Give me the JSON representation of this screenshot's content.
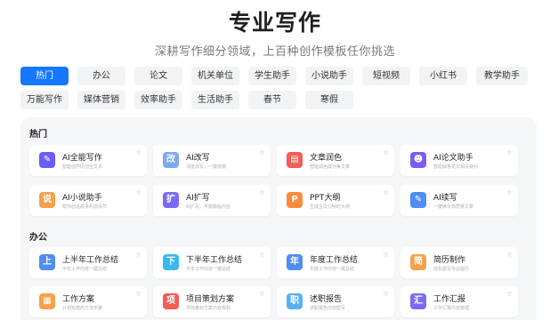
{
  "header": {
    "title": "专业写作",
    "subtitle": "深耕写作细分领域，上百种创作模板任你挑选"
  },
  "tabs": [
    {
      "label": "热门",
      "active": true
    },
    {
      "label": "办公"
    },
    {
      "label": "论文"
    },
    {
      "label": "机关单位"
    },
    {
      "label": "学生助手"
    },
    {
      "label": "小说助手"
    },
    {
      "label": "短视频"
    },
    {
      "label": "小红书"
    },
    {
      "label": "教学助手"
    },
    {
      "label": "万能写作"
    },
    {
      "label": "媒体营销"
    },
    {
      "label": "效率助手"
    },
    {
      "label": "生活助手"
    },
    {
      "label": "春节"
    },
    {
      "label": "寒假"
    }
  ],
  "sections": [
    {
      "title": "热门",
      "cards": [
        {
          "name": "AI全能写作",
          "desc": "智能创作原创全文本",
          "icon": "pen-icon",
          "glyph": "✎",
          "color": "#6b5cf6"
        },
        {
          "name": "AI改写",
          "desc": "深度改写，一键成稿",
          "icon": "rewrite-icon",
          "glyph": "改",
          "color": "#7ea8f0"
        },
        {
          "name": "文章润色",
          "desc": "智能润色成为美文章",
          "icon": "document-icon",
          "glyph": "▤",
          "color": "#f25c54"
        },
        {
          "name": "AI论文助手",
          "desc": "智能解答论文相关疑问",
          "icon": "robot-icon",
          "glyph": "☻",
          "color": "#7c5cf0"
        },
        {
          "name": "AI小说助手",
          "desc": "帮你创造故事构造情节",
          "icon": "story-icon",
          "glyph": "说",
          "color": "#f6a04a"
        },
        {
          "name": "AI扩写",
          "desc": "AI扩写，丰富篇幅内容",
          "icon": "expand-icon",
          "glyph": "扩",
          "color": "#7a6cf2"
        },
        {
          "name": "PPT大纲",
          "desc": "生成主次分明的大纲",
          "icon": "ppt-icon",
          "glyph": "P",
          "color": "#ff8a3d"
        },
        {
          "name": "AI续写",
          "desc": "一键续写高质量文章",
          "icon": "continue-icon",
          "glyph": "✎",
          "color": "#4e8df5"
        }
      ]
    },
    {
      "title": "办公",
      "cards": [
        {
          "name": "上半年工作总结",
          "desc": "半年工作内容一键总结",
          "icon": "summary-icon",
          "glyph": "上",
          "color": "#4e8df5"
        },
        {
          "name": "下半年工作总结",
          "desc": "半年工作内容一键总结",
          "icon": "summary-icon",
          "glyph": "下",
          "color": "#38b8f2"
        },
        {
          "name": "年度工作总结",
          "desc": "年度工作内容一键总结",
          "icon": "year-icon",
          "glyph": "年",
          "color": "#4e8df5"
        },
        {
          "name": "简历制作",
          "desc": "轻松撰写专业履历",
          "icon": "resume-icon",
          "glyph": "简",
          "color": "#f6a04a"
        },
        {
          "name": "工作方案",
          "desc": "计划实施的方法步骤",
          "icon": "plan-icon",
          "glyph": "▦",
          "color": "#f6a04a"
        },
        {
          "name": "项目策划方案",
          "desc": "项目策划方案内容规划",
          "icon": "project-icon",
          "glyph": "项",
          "color": "#f25c54"
        },
        {
          "name": "述职报告",
          "desc": "述职报告内容帮写",
          "icon": "report-icon",
          "glyph": "职",
          "color": "#5ab0f5"
        },
        {
          "name": "工作汇报",
          "desc": "工作汇报内容整理",
          "icon": "briefing-icon",
          "glyph": "汇",
          "color": "#7a6cf2"
        }
      ]
    }
  ]
}
